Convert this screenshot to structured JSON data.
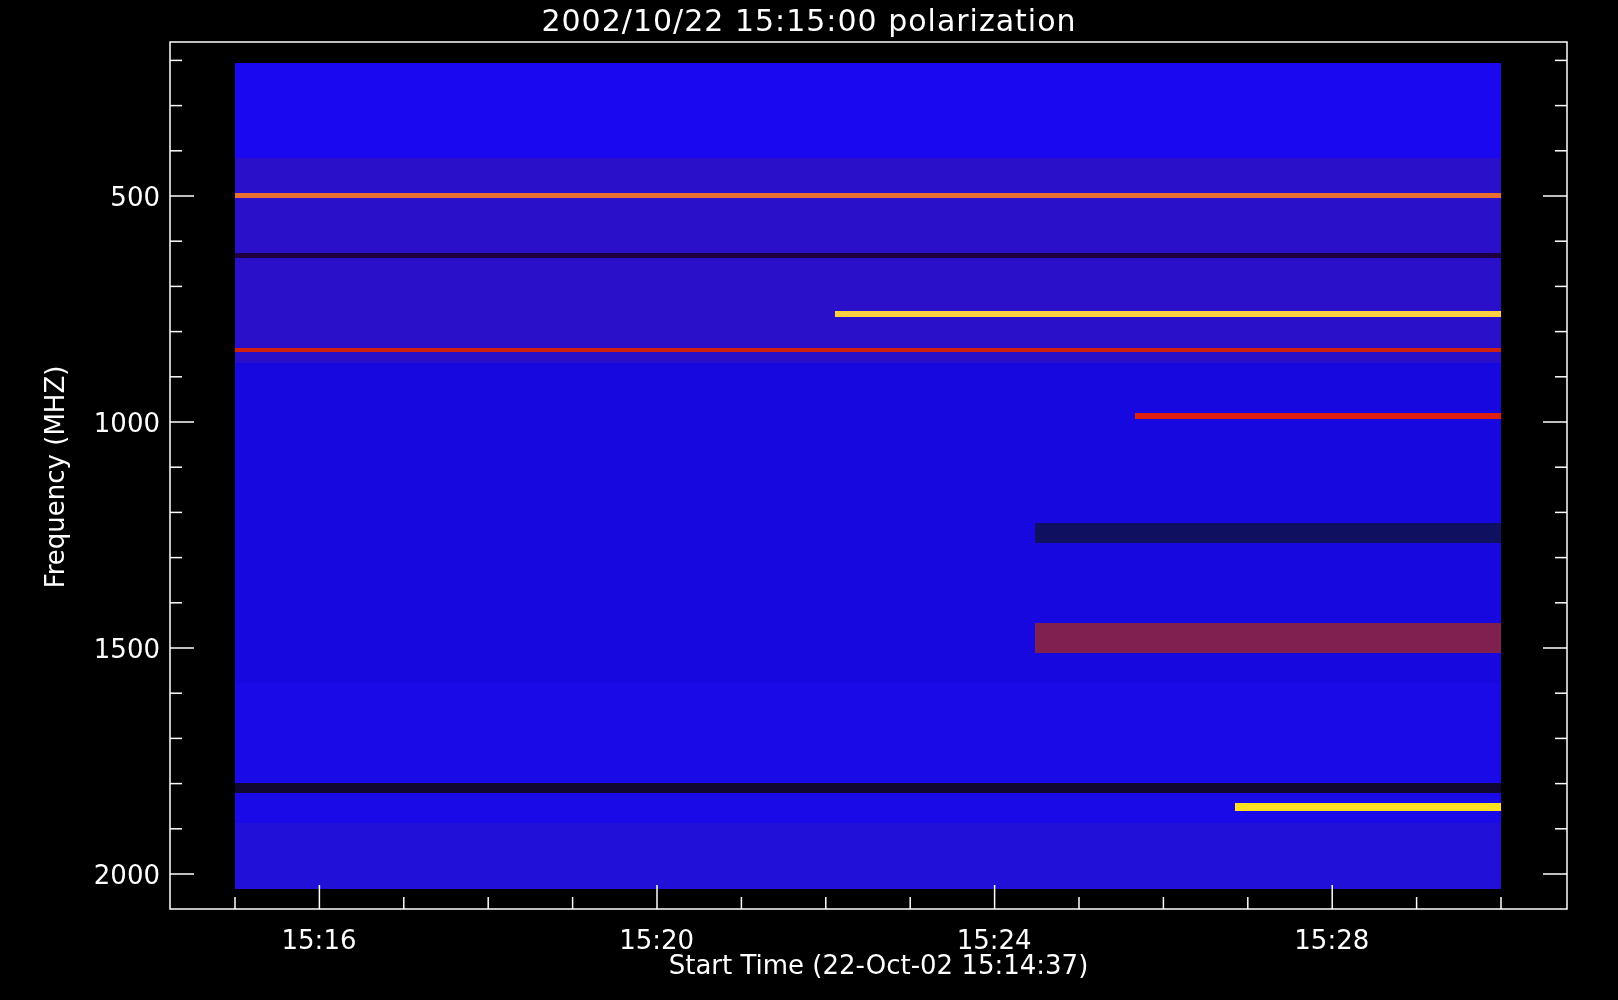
{
  "title": "2002/10/22 15:15:00 polarization",
  "plot": {
    "ylabel": "Frequency (MHZ)",
    "xlabel": "Start Time (22-Oct-02 15:14:37)",
    "yticks": [
      "500",
      "1000",
      "1500",
      "2000"
    ],
    "xticks": [
      "15:16",
      "15:20",
      "15:24",
      "15:28"
    ]
  }
}
